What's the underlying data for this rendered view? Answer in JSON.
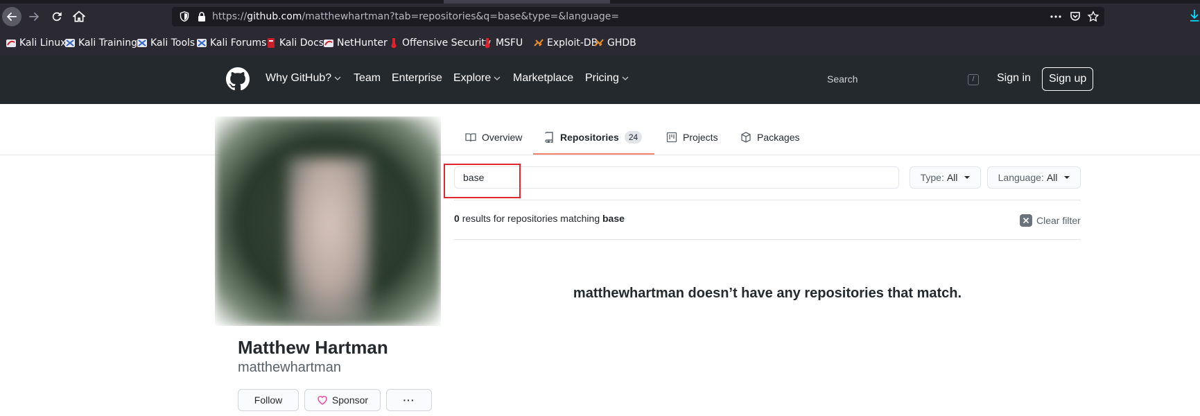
{
  "browser": {
    "url_prefix": "https://",
    "url_host": "github.com",
    "url_path": "/matthewhartman?tab=repositories&q=base&type=&language=",
    "bookmarks": [
      {
        "label": "Kali Linux",
        "icon": "kali-dragon-icon"
      },
      {
        "label": "Kali Training",
        "icon": "kali-dragon-icon"
      },
      {
        "label": "Kali Tools",
        "icon": "kali-dragon-icon"
      },
      {
        "label": "Kali Forums",
        "icon": "kali-dragon-icon"
      },
      {
        "label": "Kali Docs",
        "icon": "kali-docs-icon"
      },
      {
        "label": "NetHunter",
        "icon": "kali-dragon-icon"
      },
      {
        "label": "Offensive Security",
        "icon": "offsec-icon"
      },
      {
        "label": "MSFU",
        "icon": "offsec-icon"
      },
      {
        "label": "Exploit-DB",
        "icon": "exploitdb-icon"
      },
      {
        "label": "GHDB",
        "icon": "exploitdb-icon"
      }
    ]
  },
  "header": {
    "nav": [
      {
        "label": "Why GitHub?",
        "dropdown": true
      },
      {
        "label": "Team",
        "dropdown": false
      },
      {
        "label": "Enterprise",
        "dropdown": false
      },
      {
        "label": "Explore",
        "dropdown": true
      },
      {
        "label": "Marketplace",
        "dropdown": false
      },
      {
        "label": "Pricing",
        "dropdown": true
      }
    ],
    "search_placeholder": "Search",
    "search_shortcut": "/",
    "sign_in": "Sign in",
    "sign_up": "Sign up"
  },
  "profile": {
    "name": "Matthew Hartman",
    "login": "matthewhartman",
    "follow_label": "Follow",
    "sponsor_label": "Sponsor",
    "more_label": "···"
  },
  "tabs": [
    {
      "label": "Overview",
      "icon": "book-icon"
    },
    {
      "label": "Repositories",
      "icon": "repo-icon",
      "count": "24",
      "selected": true
    },
    {
      "label": "Projects",
      "icon": "project-icon"
    },
    {
      "label": "Packages",
      "icon": "package-icon"
    }
  ],
  "repo_filter": {
    "query": "base",
    "type_label": "Type:",
    "type_value": "All",
    "language_label": "Language:",
    "language_value": "All",
    "results_count": "0",
    "results_text": "results for repositories matching",
    "results_query": "base",
    "clear_filter": "Clear filter",
    "blankslate": "matthewhartman doesn’t have any repositories that match."
  },
  "colors": {
    "header_bg": "#24292e",
    "tab_accent": "#f9826c",
    "highlight_box": "#e0272f",
    "browser_chrome": "#2b2a33"
  }
}
